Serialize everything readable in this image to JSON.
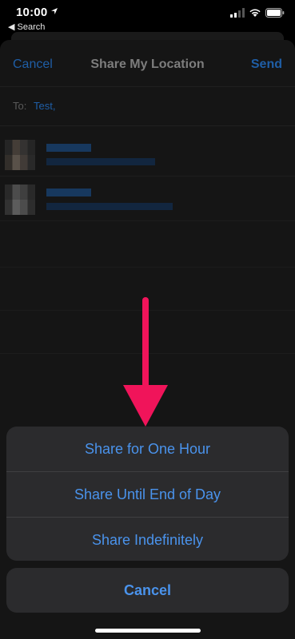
{
  "status_bar": {
    "time": "10:00",
    "back_label": "◀ Search"
  },
  "nav": {
    "cancel": "Cancel",
    "title": "Share My Location",
    "send": "Send"
  },
  "recipient": {
    "label": "To:",
    "value": "Test,"
  },
  "action_sheet": {
    "options": [
      "Share for One Hour",
      "Share Until End of Day",
      "Share Indefinitely"
    ],
    "cancel": "Cancel"
  },
  "colors": {
    "accent": "#4a93ec",
    "annotation_arrow": "#f0145a"
  }
}
